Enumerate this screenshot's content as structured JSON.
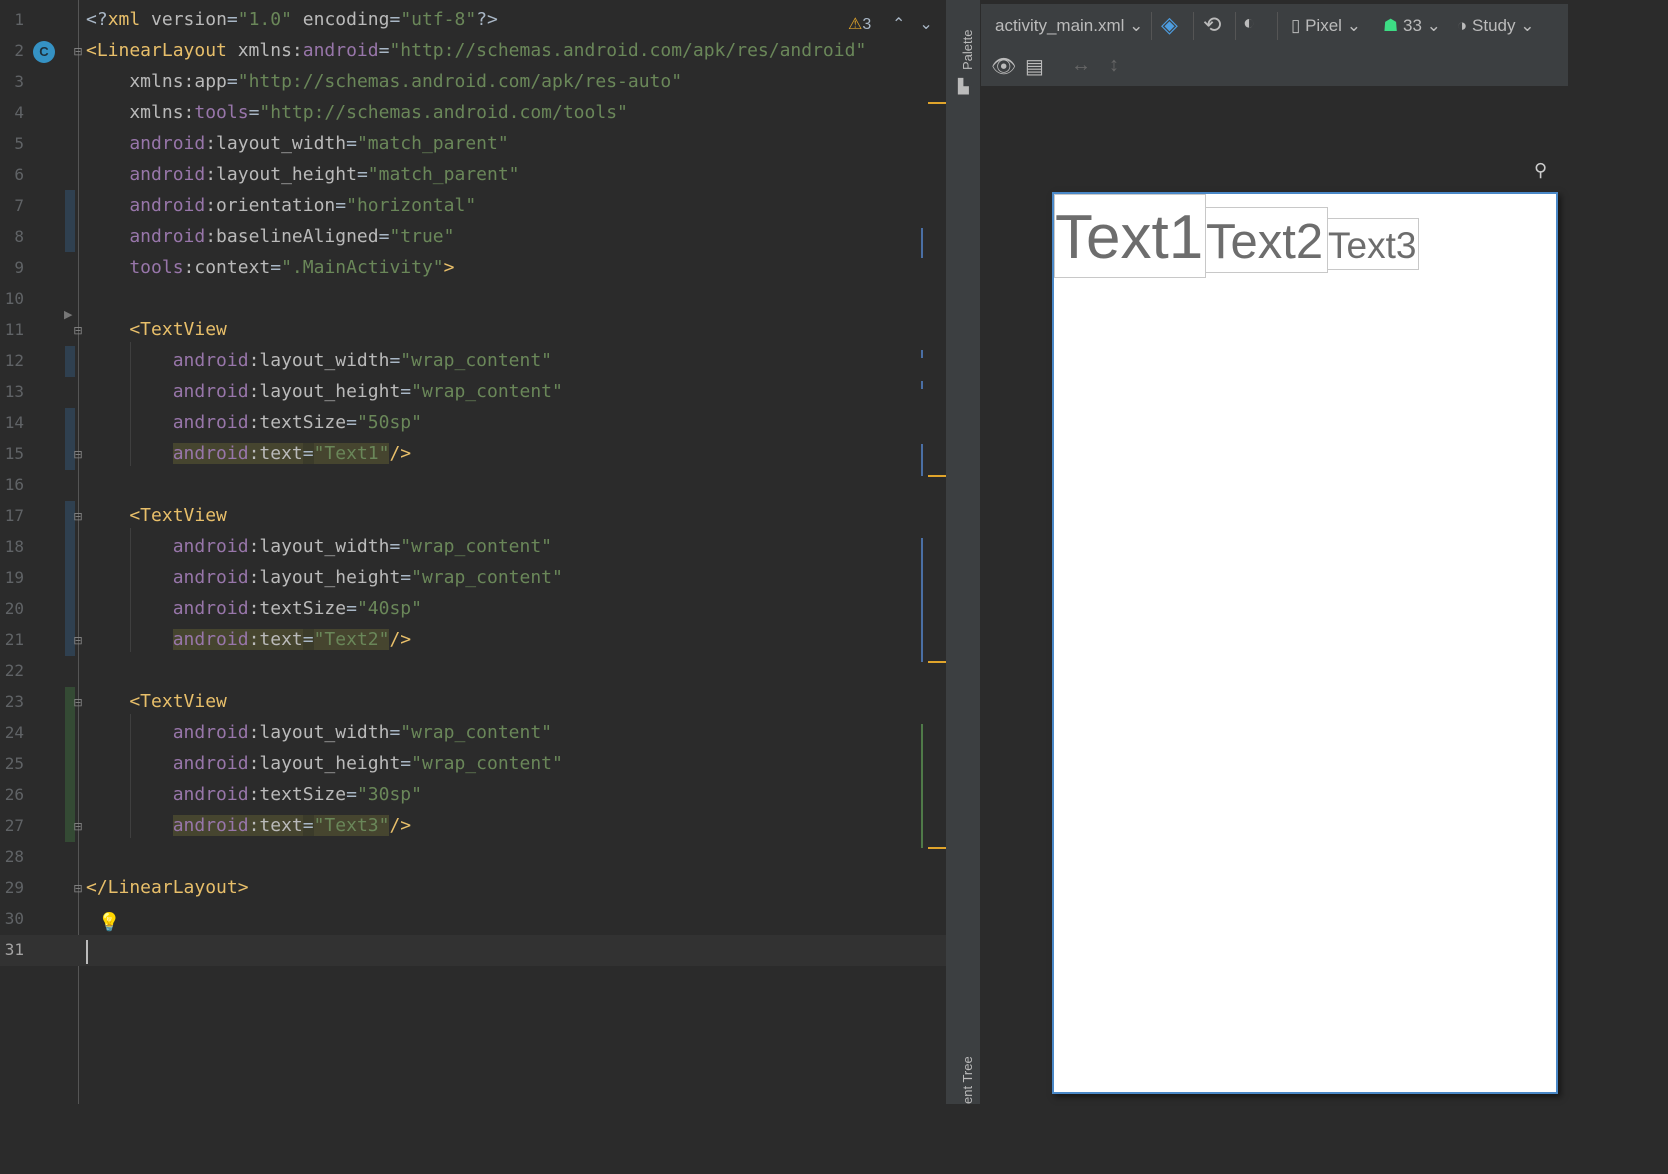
{
  "editor": {
    "warnings_count": "3",
    "lines": [
      {
        "n": "1",
        "tokens": [
          [
            "punct",
            "<?"
          ],
          [
            "tag",
            "xml "
          ],
          [
            "attr",
            "version"
          ],
          [
            "punct",
            "="
          ],
          [
            "val",
            "\"1.0\""
          ],
          [
            "attr",
            " encoding"
          ],
          [
            "punct",
            "="
          ],
          [
            "val",
            "\"utf-8\""
          ],
          [
            "punct",
            "?>"
          ]
        ]
      },
      {
        "n": "2",
        "tokens": [
          [
            "tag",
            "<LinearLayout "
          ],
          [
            "attr",
            "xmlns:"
          ],
          [
            "ns",
            "android"
          ],
          [
            "punct",
            "="
          ],
          [
            "val",
            "\"http://schemas.android.com/apk/res/android\""
          ]
        ]
      },
      {
        "n": "3",
        "tokens": [
          [
            "attr",
            "    xmlns:app"
          ],
          [
            "punct",
            "="
          ],
          [
            "val",
            "\"http://schemas.android.com/apk/res-auto\""
          ]
        ]
      },
      {
        "n": "4",
        "tokens": [
          [
            "attr",
            "    xmlns:"
          ],
          [
            "ns",
            "tools"
          ],
          [
            "punct",
            "="
          ],
          [
            "val",
            "\"http://schemas.android.com/tools\""
          ]
        ]
      },
      {
        "n": "5",
        "tokens": [
          [
            "ns",
            "    android"
          ],
          [
            "attr",
            ":layout_width"
          ],
          [
            "punct",
            "="
          ],
          [
            "val",
            "\"match_parent\""
          ]
        ]
      },
      {
        "n": "6",
        "tokens": [
          [
            "ns",
            "    android"
          ],
          [
            "attr",
            ":layout_height"
          ],
          [
            "punct",
            "="
          ],
          [
            "val",
            "\"match_parent\""
          ]
        ]
      },
      {
        "n": "7",
        "tokens": [
          [
            "ns",
            "    android"
          ],
          [
            "attr",
            ":orientation"
          ],
          [
            "punct",
            "="
          ],
          [
            "val",
            "\"horizontal\""
          ]
        ]
      },
      {
        "n": "8",
        "tokens": [
          [
            "ns",
            "    android"
          ],
          [
            "attr",
            ":baselineAligned"
          ],
          [
            "punct",
            "="
          ],
          [
            "val",
            "\"true\""
          ]
        ]
      },
      {
        "n": "9",
        "tokens": [
          [
            "ns",
            "    tools"
          ],
          [
            "attr",
            ":context"
          ],
          [
            "punct",
            "="
          ],
          [
            "val",
            "\".MainActivity\""
          ],
          [
            "tag",
            ">"
          ]
        ]
      },
      {
        "n": "10",
        "tokens": []
      },
      {
        "n": "11",
        "tokens": [
          [
            "tag",
            "    <TextView"
          ]
        ]
      },
      {
        "n": "12",
        "tokens": [
          [
            "ns",
            "        android"
          ],
          [
            "attr",
            ":layout_width"
          ],
          [
            "punct",
            "="
          ],
          [
            "val",
            "\"wrap_content\""
          ]
        ]
      },
      {
        "n": "13",
        "tokens": [
          [
            "ns",
            "        android"
          ],
          [
            "attr",
            ":layout_height"
          ],
          [
            "punct",
            "="
          ],
          [
            "val",
            "\"wrap_content\""
          ]
        ]
      },
      {
        "n": "14",
        "tokens": [
          [
            "ns",
            "        android"
          ],
          [
            "attr",
            ":textSize"
          ],
          [
            "punct",
            "="
          ],
          [
            "val",
            "\"50sp\""
          ]
        ]
      },
      {
        "n": "15",
        "tokens": [
          [
            "pad",
            "        "
          ],
          [
            "ns-hl",
            "android"
          ],
          [
            "attr-hl",
            ":text"
          ],
          [
            "punct-hl",
            "="
          ],
          [
            "val-hl",
            "\"Text1\""
          ],
          [
            "tag",
            "/>"
          ]
        ]
      },
      {
        "n": "16",
        "tokens": []
      },
      {
        "n": "17",
        "tokens": [
          [
            "tag",
            "    <TextView"
          ]
        ]
      },
      {
        "n": "18",
        "tokens": [
          [
            "ns",
            "        android"
          ],
          [
            "attr",
            ":layout_width"
          ],
          [
            "punct",
            "="
          ],
          [
            "val",
            "\"wrap_content\""
          ]
        ]
      },
      {
        "n": "19",
        "tokens": [
          [
            "ns",
            "        android"
          ],
          [
            "attr",
            ":layout_height"
          ],
          [
            "punct",
            "="
          ],
          [
            "val",
            "\"wrap_content\""
          ]
        ]
      },
      {
        "n": "20",
        "tokens": [
          [
            "ns",
            "        android"
          ],
          [
            "attr",
            ":textSize"
          ],
          [
            "punct",
            "="
          ],
          [
            "val",
            "\"40sp\""
          ]
        ]
      },
      {
        "n": "21",
        "tokens": [
          [
            "pad",
            "        "
          ],
          [
            "ns-hl",
            "android"
          ],
          [
            "attr-hl",
            ":text"
          ],
          [
            "punct-hl",
            "="
          ],
          [
            "val-hl",
            "\"Text2\""
          ],
          [
            "tag",
            "/>"
          ]
        ]
      },
      {
        "n": "22",
        "tokens": []
      },
      {
        "n": "23",
        "tokens": [
          [
            "tag",
            "    <TextView"
          ]
        ]
      },
      {
        "n": "24",
        "tokens": [
          [
            "ns",
            "        android"
          ],
          [
            "attr",
            ":layout_width"
          ],
          [
            "punct",
            "="
          ],
          [
            "val",
            "\"wrap_content\""
          ]
        ]
      },
      {
        "n": "25",
        "tokens": [
          [
            "ns",
            "        android"
          ],
          [
            "attr",
            ":layout_height"
          ],
          [
            "punct",
            "="
          ],
          [
            "val",
            "\"wrap_content\""
          ]
        ]
      },
      {
        "n": "26",
        "tokens": [
          [
            "ns",
            "        android"
          ],
          [
            "attr",
            ":textSize"
          ],
          [
            "punct",
            "="
          ],
          [
            "val",
            "\"30sp\""
          ]
        ]
      },
      {
        "n": "27",
        "tokens": [
          [
            "pad",
            "        "
          ],
          [
            "ns-hl",
            "android"
          ],
          [
            "attr-hl",
            ":text"
          ],
          [
            "punct-hl",
            "="
          ],
          [
            "val-hl",
            "\"Text3\""
          ],
          [
            "tag",
            "/>"
          ]
        ]
      },
      {
        "n": "28",
        "tokens": []
      },
      {
        "n": "29",
        "tokens": [
          [
            "tag",
            "</LinearLayout>"
          ]
        ]
      },
      {
        "n": "30",
        "tokens": []
      },
      {
        "n": "31",
        "tokens": []
      }
    ],
    "current_line": "31"
  },
  "side_panel": {
    "palette_label": "Palette",
    "component_tree_label": "ent Tree"
  },
  "design_toolbar": {
    "file_name": "activity_main.xml",
    "device": "Pixel",
    "api_level": "33",
    "theme": "Study"
  },
  "preview": {
    "text1": "Text1",
    "text2": "Text2",
    "text3": "Text3"
  },
  "colors": {
    "editor_bg": "#2b2b2b",
    "tag": "#e8bf6a",
    "namespace": "#9876aa",
    "value": "#6a8759",
    "warning": "#e0a42b",
    "selection_border": "#4a88c7"
  }
}
